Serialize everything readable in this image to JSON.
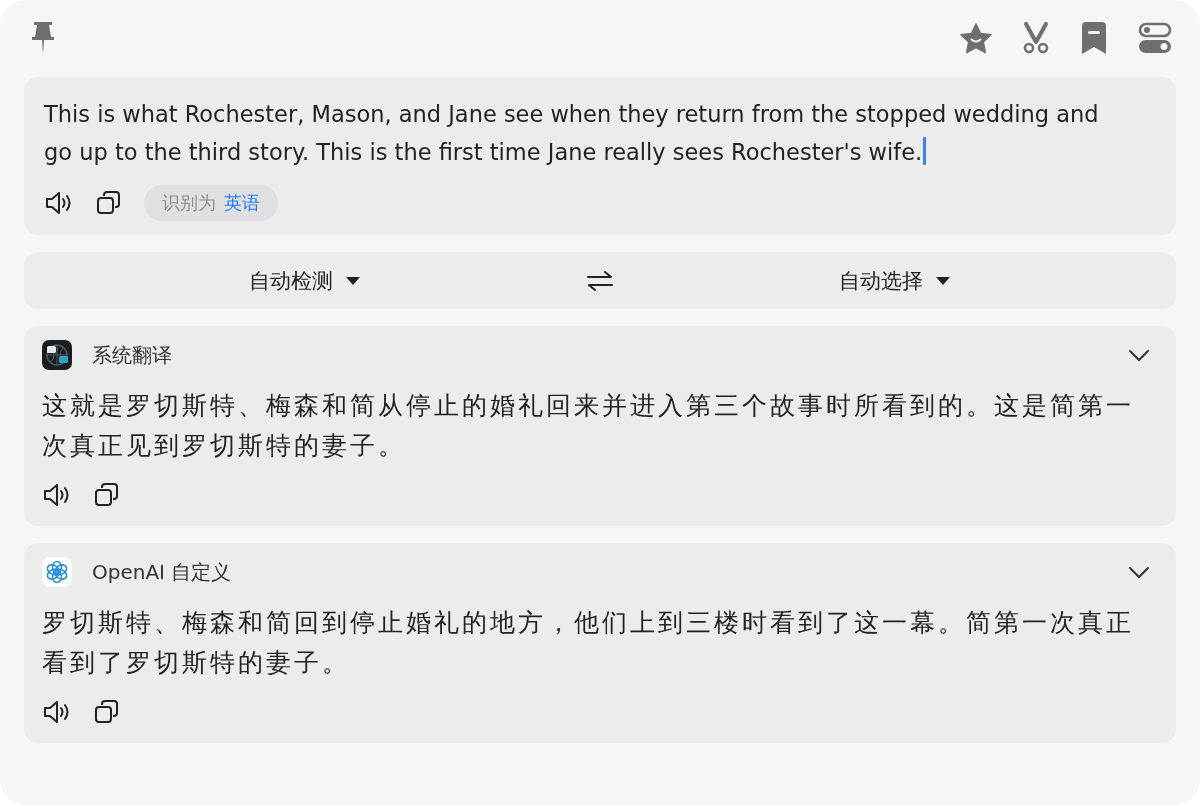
{
  "source": {
    "text": "This is what Rochester, Mason, and Jane see when they return from the stopped wedding and go up to the third story. This is the first time Jane really sees Rochester's wife.",
    "detected_label": "识别为",
    "detected_language": "英语"
  },
  "languages": {
    "from": "自动检测",
    "to": "自动选择"
  },
  "results": [
    {
      "kind": "system",
      "name": "系统翻译",
      "text": "这就是罗切斯特、梅森和简从停止的婚礼回来并进入第三个故事时所看到的。这是简第一次真正见到罗切斯特的妻子。"
    },
    {
      "kind": "openai",
      "name": "OpenAI 自定义",
      "text": "罗切斯特、梅森和简回到停止婚礼的地方，他们上到三楼时看到了这一幕。简第一次真正看到了罗切斯特的妻子。"
    }
  ]
}
